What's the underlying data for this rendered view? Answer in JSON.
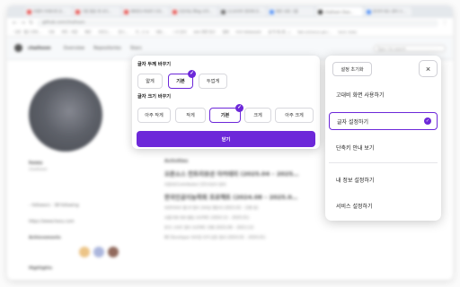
{
  "browser": {
    "tabs": [
      "부캠이 하계수련 공…",
      "구름 팔꿈 계 코디…",
      "레퍼런스하네이 디자…",
      "인공지능 Blog 코치…",
      "(소)코리아 정의애 모…",
      "화반 사회 그룹",
      "chaihoon (hoo…",
      "한국어 테스 관리 스…"
    ],
    "url": "github.com/chaihoon",
    "bookmarks": [
      "나만 - 웹그 모바…",
      "기초",
      "파트 - 비문",
      "메모",
      "프로고…",
      "문스…",
      "기…스 D",
      "내보…",
      "ㄴ다 장사",
      "WiFi 화면 링크",
      "결제",
      "POP MANAGER",
      "골 작 제 (화…)",
      "Talk entrance gen…",
      "tonic mate"
    ],
    "search_placeholder": "Type / to search"
  },
  "github": {
    "user": "chaihoon",
    "tabs": [
      "Overview",
      "Repositories",
      "Stars"
    ],
    "profile_name": "hoeu",
    "profile_handle": "chaihoon",
    "followers": "– followers · 38 following",
    "website": "https://www.hoeu.com",
    "achievements_label": "Achievements",
    "highlights_label": "Highlights",
    "activities_label": "Activities",
    "feed": [
      "오픈소스 컨트리뷰션 아카데미 (2025.04 – 2025…",
      "지원자(Contributor) 컨트리뷰터 참여",
      "한국인공지능학회 프로젝트 (2024.08 – 2025.0…",
      "자연어처리 웹 UI 멀티 모바일 챌린지 (2023.02 – 진행 중)",
      "서울국제 대외 활동 프로젝트 (2024.12 – 2025.01)",
      "한국 스마트 멀티 프로젝트 진행 (2023.06 – 2023.12)",
      "BE Developer 버추얼 자격 검증 결과 (2024.02 – 2024.01)"
    ]
  },
  "font_panel": {
    "weight_heading": "글자 두께 바꾸기",
    "weight_options": [
      "얇게",
      "기본",
      "두껍게"
    ],
    "weight_selected": "기본",
    "size_heading": "글자 크기 바꾸기",
    "size_options": [
      "아주 작게",
      "작게",
      "기본",
      "크게",
      "아주 크게"
    ],
    "size_selected": "기본",
    "close_label": "닫기",
    "accent": "#6d28d9"
  },
  "a11y_menu": {
    "reset_label": "설정 초기화",
    "close_icon": "×",
    "items": [
      "고대비 화면 사용하기",
      "글자 설정하기",
      "단축키 안내 보기",
      "내 정보 설정하기",
      "서비스 설정하기"
    ],
    "selected_item": "글자 설정하기",
    "check_icon": "✓"
  }
}
